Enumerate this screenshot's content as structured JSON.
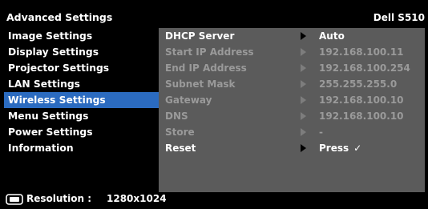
{
  "header": {
    "title": "Advanced Settings",
    "model": "Dell S510"
  },
  "nav": {
    "items": [
      {
        "label": "Image Settings",
        "active": false
      },
      {
        "label": "Display Settings",
        "active": false
      },
      {
        "label": "Projector Settings",
        "active": false
      },
      {
        "label": "LAN Settings",
        "active": false
      },
      {
        "label": "Wireless Settings",
        "active": true
      },
      {
        "label": "Menu Settings",
        "active": false
      },
      {
        "label": "Power Settings",
        "active": false
      },
      {
        "label": "Information",
        "active": false
      }
    ]
  },
  "settings": {
    "rows": [
      {
        "label": "DHCP Server",
        "value": "Auto",
        "enabled": true
      },
      {
        "label": "Start IP Address",
        "value": "192.168.100.11",
        "enabled": false
      },
      {
        "label": "End IP Address",
        "value": "192.168.100.254",
        "enabled": false
      },
      {
        "label": "Subnet Mask",
        "value": "255.255.255.0",
        "enabled": false
      },
      {
        "label": "Gateway",
        "value": "192.168.100.10",
        "enabled": false
      },
      {
        "label": "DNS",
        "value": "192.168.100.10",
        "enabled": false
      },
      {
        "label": "Store",
        "value": "-",
        "enabled": false
      },
      {
        "label": "Reset",
        "value": "Press",
        "enabled": true,
        "check": "✓"
      }
    ]
  },
  "status": {
    "resolution_label": "Resolution :",
    "resolution_value": "1280x1024",
    "icon": "input-source-icon"
  },
  "colors": {
    "background": "#000000",
    "panel": "#5b5b5b",
    "highlight": "#2b6bc0",
    "text_enabled": "#ffffff",
    "text_disabled": "#9a9a9a"
  }
}
